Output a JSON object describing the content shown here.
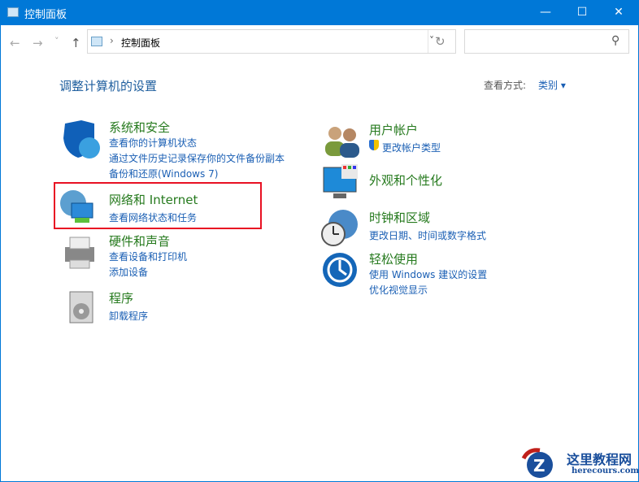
{
  "window": {
    "title": "控制面板",
    "minimize": "—",
    "maximize": "☐",
    "close": "✕"
  },
  "nav": {
    "back": "←",
    "forward": "→",
    "recent": "˅",
    "up": "↑",
    "breadcrumb_sep": "›",
    "breadcrumb": "控制面板",
    "dropdown": "˅",
    "refresh": "↻",
    "search_placeholder": "",
    "search_icon": "⚲"
  },
  "header": {
    "title": "调整计算机的设置",
    "view_label": "查看方式:",
    "view_value": "类别",
    "view_arrow": "▾"
  },
  "categories": [
    {
      "title": "系统和安全",
      "links": [
        "查看你的计算机状态",
        "通过文件历史记录保存你的文件备份副本",
        "备份和还原(Windows 7)"
      ]
    },
    {
      "title": "网络和 Internet",
      "links": [
        "查看网络状态和任务"
      ]
    },
    {
      "title": "硬件和声音",
      "links": [
        "查看设备和打印机",
        "添加设备"
      ]
    },
    {
      "title": "程序",
      "links": [
        "卸载程序"
      ]
    },
    {
      "title": "用户帐户",
      "links": [
        "更改帐户类型"
      ]
    },
    {
      "title": "外观和个性化",
      "links": []
    },
    {
      "title": "时钟和区域",
      "links": [
        "更改日期、时间或数字格式"
      ]
    },
    {
      "title": "轻松使用",
      "links": [
        "使用 Windows 建议的设置",
        "优化视觉显示"
      ]
    }
  ],
  "watermark": {
    "name": "这里教程网",
    "url": "herecours.com"
  }
}
